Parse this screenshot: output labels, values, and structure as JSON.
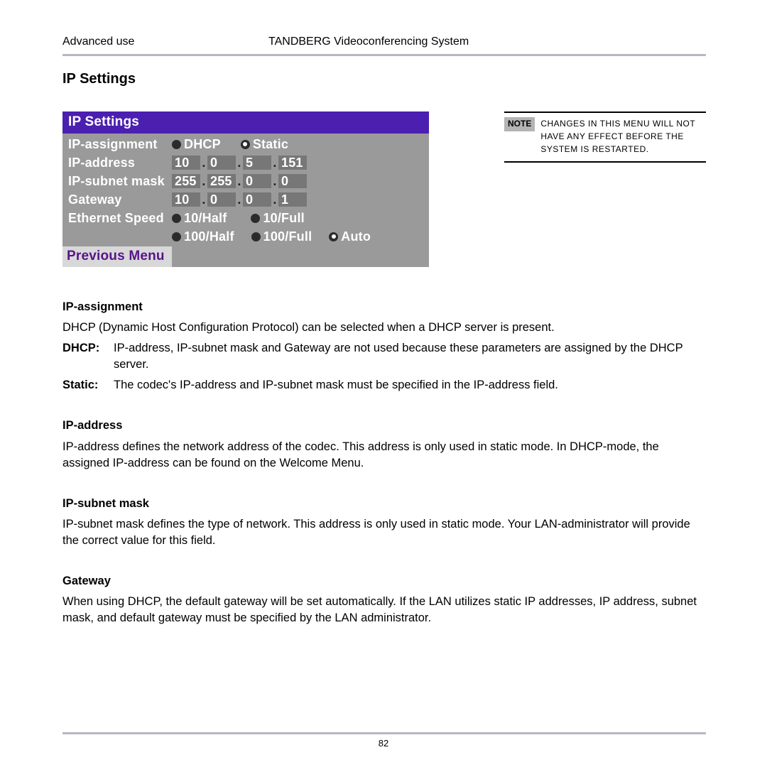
{
  "header": {
    "left": "Advanced use",
    "center": "TANDBERG Videoconferencing System"
  },
  "section_title": "IP Settings",
  "dialog": {
    "title": "IP Settings",
    "rows": {
      "assignment_label": "IP-assignment",
      "assignment_opts": {
        "dhcp": "DHCP",
        "static": "Static",
        "selected": "static"
      },
      "address_label": "IP-address",
      "address_octets": [
        "10",
        "0",
        "5",
        "151"
      ],
      "subnet_label": "IP-subnet mask",
      "subnet_octets": [
        "255",
        "255",
        "0",
        "0"
      ],
      "gateway_label": "Gateway",
      "gateway_octets": [
        "10",
        "0",
        "0",
        "1"
      ],
      "speed_label": "Ethernet Speed",
      "speed_opts": {
        "h10": "10/Half",
        "f10": "10/Full",
        "h100": "100/Half",
        "f100": "100/Full",
        "auto": "Auto",
        "selected": "auto"
      }
    },
    "prev": "Previous Menu"
  },
  "note": {
    "badge": "NOTE",
    "text": "CHANGES IN THIS MENU WILL NOT HAVE ANY EFFECT BEFORE THE SYSTEM IS RESTARTED."
  },
  "sections": {
    "ip_assignment": {
      "title": "IP-assignment",
      "intro": "DHCP (Dynamic Host Configuration Protocol) can be selected when a DHCP server is present.",
      "dhcp_term": "DHCP:",
      "dhcp_desc": "IP-address, IP-subnet mask and Gateway are not used because these parameters are assigned by the DHCP server.",
      "static_term": "Static:",
      "static_desc": "The codec's IP-address and IP-subnet mask must be specified in the IP-address field."
    },
    "ip_address": {
      "title": "IP-address",
      "text": "IP-address defines the network address of the codec. This address is only used in static mode. In DHCP-mode, the assigned IP-address can be found on the Welcome Menu."
    },
    "subnet": {
      "title": "IP-subnet mask",
      "text": "IP-subnet mask defines the type of network. This address is only used in static mode. Your LAN-administrator will provide the correct value for this field."
    },
    "gateway": {
      "title": "Gateway",
      "text": "When using DHCP, the default gateway will be set automatically. If the LAN utilizes static IP addresses, IP address, subnet mask, and default gateway must be specified by the LAN administrator."
    }
  },
  "page_number": "82"
}
